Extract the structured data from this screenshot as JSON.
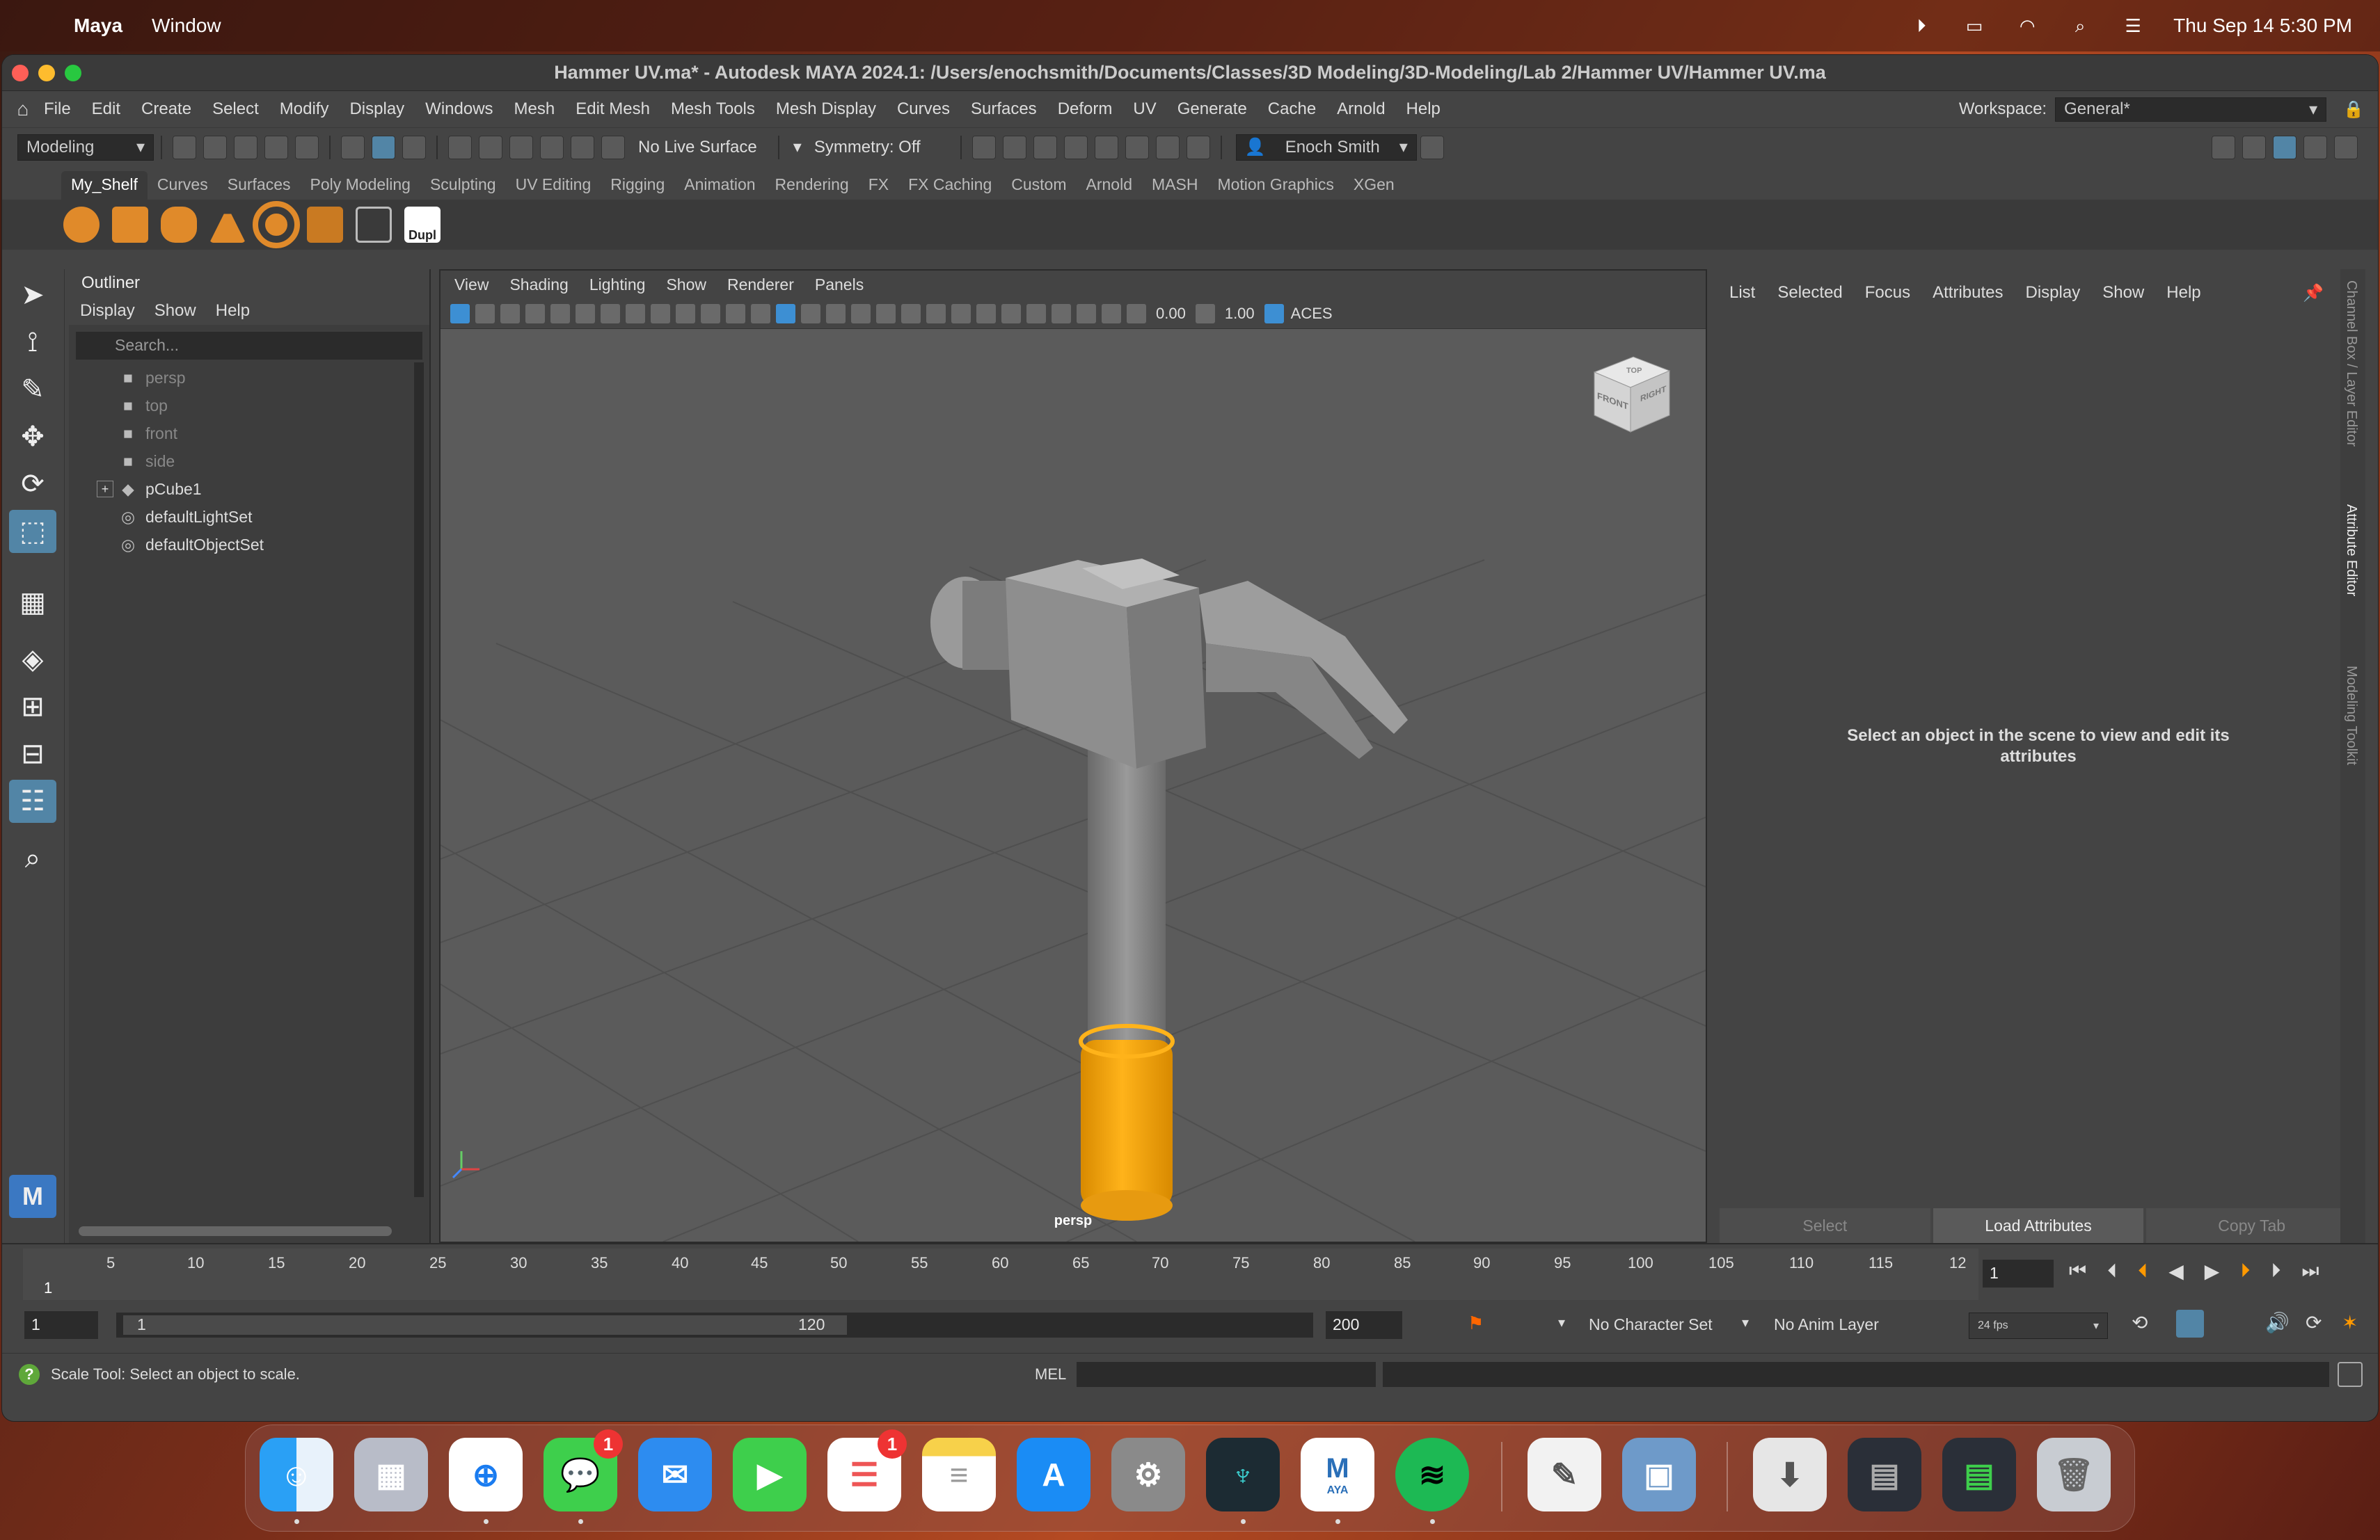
{
  "menubar": {
    "app": "Maya",
    "items": [
      "Window"
    ],
    "clock": "Thu Sep 14  5:30 PM"
  },
  "window": {
    "title": "Hammer UV.ma* - Autodesk MAYA 2024.1: /Users/enochsmith/Documents/Classes/3D Modeling/3D-Modeling/Lab 2/Hammer UV/Hammer UV.ma",
    "menu": [
      "File",
      "Edit",
      "Create",
      "Select",
      "Modify",
      "Display",
      "Windows",
      "Mesh",
      "Edit Mesh",
      "Mesh Tools",
      "Mesh Display",
      "Curves",
      "Surfaces",
      "Deform",
      "UV",
      "Generate",
      "Cache",
      "Arnold",
      "Help"
    ],
    "workspace_label": "Workspace:",
    "workspace_value": "General*"
  },
  "statusline": {
    "mode": "Modeling",
    "live_surface": "No Live Surface",
    "symmetry": "Symmetry: Off",
    "user": "Enoch Smith"
  },
  "shelf": {
    "tabs": [
      "My_Shelf",
      "Curves",
      "Surfaces",
      "Poly Modeling",
      "Sculpting",
      "UV Editing",
      "Rigging",
      "Animation",
      "Rendering",
      "FX",
      "FX Caching",
      "Custom",
      "Arnold",
      "MASH",
      "Motion Graphics",
      "XGen"
    ],
    "active_tab": "My_Shelf",
    "dupl_label": "Dupl"
  },
  "outliner": {
    "title": "Outliner",
    "menu": [
      "Display",
      "Show",
      "Help"
    ],
    "search_placeholder": "Search...",
    "items": [
      {
        "label": "persp",
        "kind": "camera"
      },
      {
        "label": "top",
        "kind": "camera"
      },
      {
        "label": "front",
        "kind": "camera"
      },
      {
        "label": "side",
        "kind": "camera"
      },
      {
        "label": "pCube1",
        "kind": "mesh"
      },
      {
        "label": "defaultLightSet",
        "kind": "set"
      },
      {
        "label": "defaultObjectSet",
        "kind": "set"
      }
    ]
  },
  "viewport": {
    "menu": [
      "View",
      "Shading",
      "Lighting",
      "Show",
      "Renderer",
      "Panels"
    ],
    "exposure": "0.00",
    "gamma": "1.00",
    "colorspace": "ACES",
    "camera_label": "persp",
    "viewcube": {
      "front": "FRONT",
      "right": "RIGHT",
      "top": "TOP"
    }
  },
  "attribute_editor": {
    "menu": [
      "List",
      "Selected",
      "Focus",
      "Attributes",
      "Display",
      "Show",
      "Help"
    ],
    "message_line1": "Select an object in the scene to view and edit its",
    "message_line2": "attributes",
    "buttons": {
      "select": "Select",
      "load": "Load Attributes",
      "copy": "Copy Tab"
    },
    "side_tabs": [
      "Channel Box / Layer Editor",
      "Attribute Editor",
      "Modeling Toolkit"
    ]
  },
  "timeline": {
    "ticks": [
      "5",
      "10",
      "15",
      "20",
      "25",
      "30",
      "35",
      "40",
      "45",
      "50",
      "55",
      "60",
      "65",
      "70",
      "75",
      "80",
      "85",
      "90",
      "95",
      "100",
      "105",
      "110",
      "115",
      "12"
    ],
    "current_marker": "1",
    "current_frame": "1"
  },
  "range": {
    "start": "1",
    "inner_start": "1",
    "inner_end": "120",
    "end": "200",
    "character_set": "No Character Set",
    "anim_layer": "No Anim Layer",
    "fps": "24 fps"
  },
  "helpline": {
    "message": "Scale Tool: Select an object to scale.",
    "mel_label": "MEL"
  },
  "dock": {
    "messages_badge": "1",
    "reminders_badge": "1",
    "maya_label": "AYA"
  },
  "colors": {
    "accent": "#5285a6",
    "grip": "#f5a300",
    "metal": "#8c8c8c"
  }
}
